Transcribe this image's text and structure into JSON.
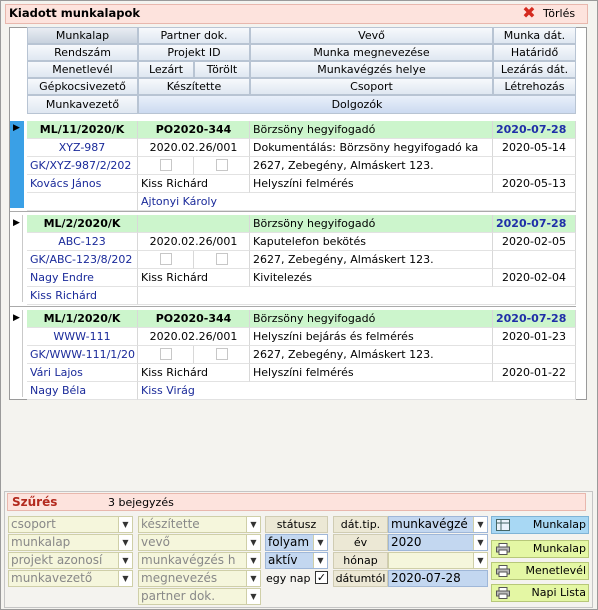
{
  "title": "Kiadott munkalapok",
  "delete_label": "Törlés",
  "headers": {
    "munkalap": "Munkalap",
    "partner_dok": "Partner dok.",
    "vevo": "Vevő",
    "munka_dat": "Munka dát.",
    "rendszam": "Rendszám",
    "projekt_id": "Projekt ID",
    "munka_megnevezese": "Munka megnevezése",
    "hatarido": "Határidő",
    "menetlevel": "Menetlevél",
    "lezart": "Lezárt",
    "torolt": "Törölt",
    "munkavegzes_helye": "Munkavégzés helye",
    "lezaras_dat": "Lezárás dát.",
    "gepkocsivezeto": "Gépkocsivezető",
    "keszitette": "Készítette",
    "csoport": "Csoport",
    "letrehozas": "Létrehozás",
    "munkavezeto": "Munkavezető",
    "dolgozok": "Dolgozók"
  },
  "records": [
    {
      "munkalap": "ML/11/2020/K",
      "partner_dok": "PO2020-344",
      "vevo": "Börzsöny hegyifogadó",
      "munka_dat": "2020-07-28",
      "rendszam": "XYZ-987",
      "projekt_id": "2020.02.26/001",
      "munka_megnevezese": "Dokumentálás: Börzsöny hegyifogadó ka",
      "hatarido": "2020-05-14",
      "menetlevel": "GK/XYZ-987/2/202",
      "munkavegzes_helye": "2627, Zebegény, Almáskert 123.",
      "lezaras_dat": "",
      "gepkocsivezeto": "Kovács János",
      "keszitette": "Kiss Richárd",
      "csoport": "Helyszíni felmérés",
      "letrehozas": "2020-05-13",
      "munkavezeto": "",
      "dolgozok": "Ajtonyi Károly"
    },
    {
      "munkalap": "ML/2/2020/K",
      "partner_dok": "",
      "vevo": "Börzsöny hegyifogadó",
      "munka_dat": "2020-07-28",
      "rendszam": "ABC-123",
      "projekt_id": "2020.02.26/001",
      "munka_megnevezese": "Kaputelefon bekötés",
      "hatarido": "2020-02-05",
      "menetlevel": "GK/ABC-123/8/202",
      "munkavegzes_helye": "2627, Zebegény, Almáskert 123.",
      "lezaras_dat": "",
      "gepkocsivezeto": "Nagy Endre",
      "keszitette": "Kiss Richárd",
      "csoport": "Kivitelezés",
      "letrehozas": "2020-02-04",
      "munkavezeto": "Kiss Richárd",
      "dolgozok": ""
    },
    {
      "munkalap": "ML/1/2020/K",
      "partner_dok": "PO2020-344",
      "vevo": "Börzsöny hegyifogadó",
      "munka_dat": "2020-07-28",
      "rendszam": "WWW-111",
      "projekt_id": "2020.02.26/001",
      "munka_megnevezese": "Helyszíni bejárás és felmérés",
      "hatarido": "2020-01-23",
      "menetlevel": "GK/WWW-111/1/20",
      "munkavegzes_helye": "2627, Zebegény, Almáskert 123.",
      "lezaras_dat": "",
      "gepkocsivezeto": "Vári Lajos",
      "keszitette": "Kiss Richárd",
      "csoport": "Helyszíni felmérés",
      "letrehozas": "2020-01-22",
      "munkavezeto": "Nagy Béla",
      "dolgozok": "Kiss Virág"
    }
  ],
  "filter": {
    "title": "Szűrés",
    "count": "3 bejegyzés",
    "csoport": "csoport",
    "munkalap": "munkalap",
    "projekt": "projekt azonosí",
    "munkavezeto": "munkavezető",
    "keszitette": "készítette",
    "vevo": "vevő",
    "munkavegzes": "munkavégzés h",
    "megnevezes": "megnevezés",
    "partner": "partner dok.",
    "statusz_label": "státusz",
    "statusz1": "folyam",
    "statusz2": "aktív",
    "egy_nap_label": "egy nap",
    "egy_nap_check": "✓",
    "dat_tip_label": "dát.tip.",
    "dat_tip_value": "munkavégzé",
    "ev_label": "év",
    "ev_value": "2020",
    "honap_label": "hónap",
    "honap_value": "",
    "datumtol_label": "dátumtól",
    "datumtol_value": "2020-07-28"
  },
  "buttons": {
    "munkalap_blue": "Munkalap",
    "munkalap_print": "Munkalap",
    "menetlevel": "Menetlevél",
    "napi_lista": "Napi Lista"
  }
}
